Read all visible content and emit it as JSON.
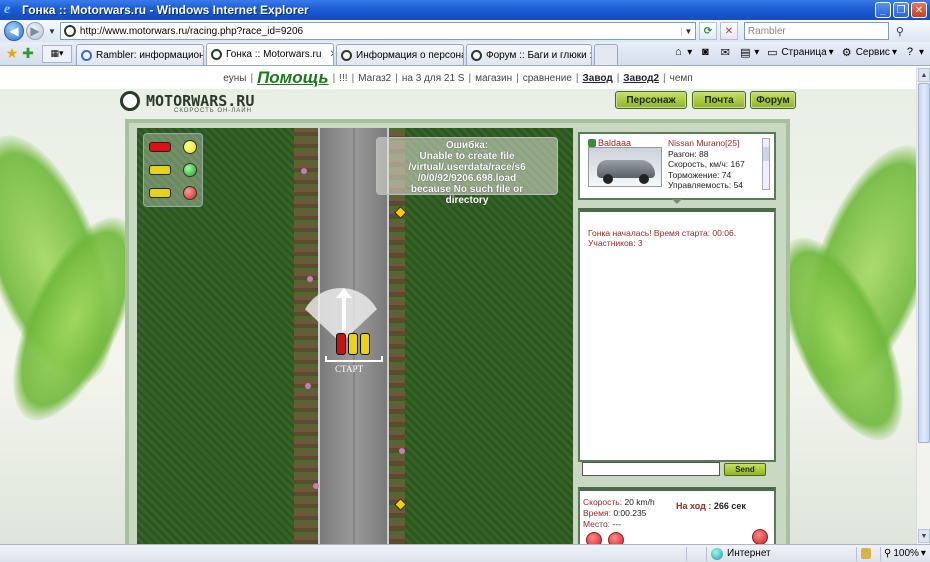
{
  "window": {
    "title": "Гонка :: Motorwars.ru - Windows Internet Explorer"
  },
  "address": {
    "url": "http://www.motorwars.ru/racing.php?race_id=9206",
    "search_placeholder": "Rambler"
  },
  "tabs": [
    {
      "label": "Rambler: информационно-п...",
      "active": false
    },
    {
      "label": "Гонка :: Motorwars.ru",
      "active": true
    },
    {
      "label": "Информация о персонаже :...",
      "active": false
    },
    {
      "label": "Форум :: Баги и глюки :: М...",
      "active": false
    }
  ],
  "toolbar": {
    "page_label": "Страница",
    "tools_label": "Сервис"
  },
  "topnav": {
    "items": [
      "еуны",
      "Помощь",
      "!!!",
      "Магаз2",
      "на 3 для 21 S",
      "магазин",
      "сравнение",
      "Завод",
      "Завод2",
      "чемп"
    ]
  },
  "site": {
    "logo": "MOTORWARS.RU",
    "logo_sub": "СКОРОСТЬ ОН-ЛАЙН",
    "buttons": {
      "character": "Персонаж",
      "mail": "Почта",
      "forum": "Форум"
    }
  },
  "race": {
    "error_lines": [
      "Ошибка:",
      "Unable to create file",
      "/virtual/.userdata/race/s6",
      "/0/0/92/9206.698.load",
      "because No such file or",
      "directory"
    ],
    "start_label": "СТАРТ"
  },
  "player": {
    "username": "Baldaaa",
    "car": "Nissan Murano[25]",
    "stats": [
      {
        "label": "Разгон",
        "value": "88"
      },
      {
        "label": "Скорость, км/ч",
        "value": "167"
      },
      {
        "label": "Торможение",
        "value": "74"
      },
      {
        "label": "Управляемость",
        "value": "54"
      }
    ]
  },
  "chat": {
    "messages": [
      "Гонка началась! Время старта: 00:06.",
      "Участников: 3"
    ],
    "send_label": "Send"
  },
  "racestats": {
    "speed_label": "Скорость:",
    "speed_value": "20 km/h",
    "time_label": "Время:",
    "time_value": "0:00.235",
    "place_label": "Место:",
    "place_value": "---",
    "turn_label": "На ход :",
    "turn_value": "266 сек"
  },
  "statusbar": {
    "zone": "Интернет",
    "zoom": "100%"
  }
}
